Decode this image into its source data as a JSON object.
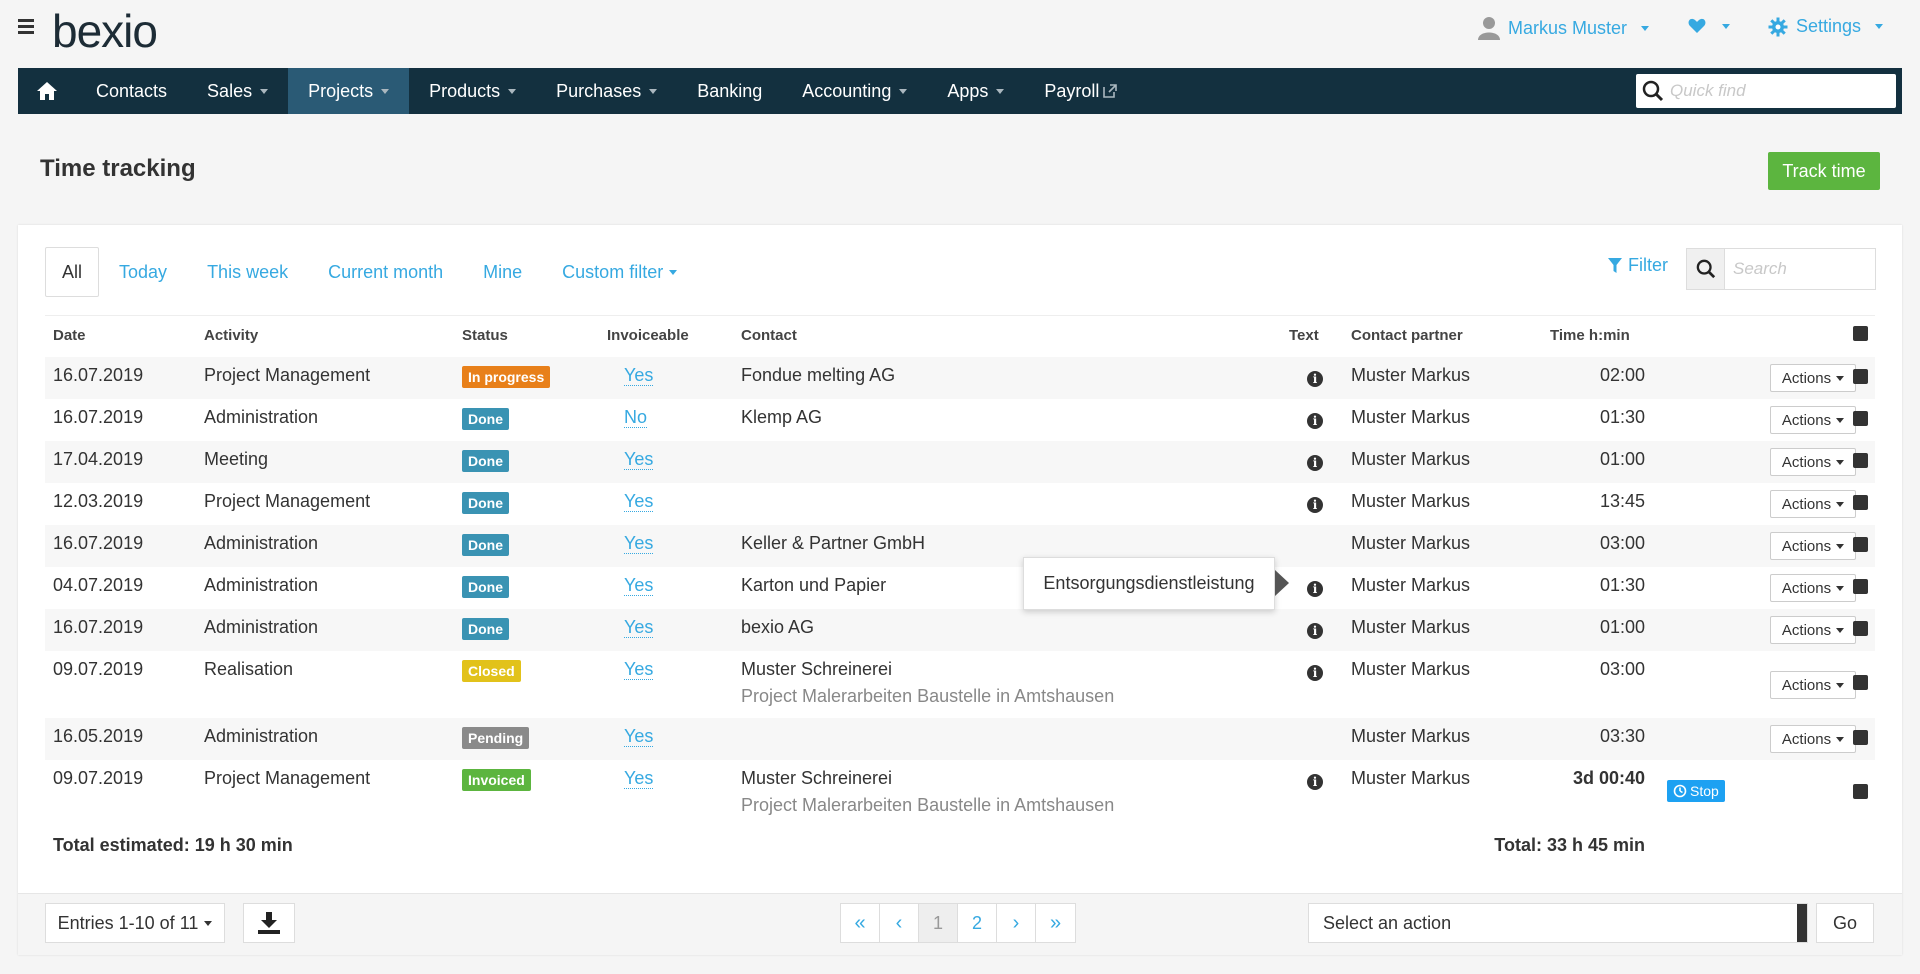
{
  "header": {
    "logo": "bexio",
    "user_name": "Markus Muster",
    "settings_label": "Settings"
  },
  "nav": {
    "items": [
      {
        "label": "Contacts",
        "caret": false
      },
      {
        "label": "Sales",
        "caret": true
      },
      {
        "label": "Projects",
        "caret": true,
        "active": true
      },
      {
        "label": "Products",
        "caret": true
      },
      {
        "label": "Purchases",
        "caret": true
      },
      {
        "label": "Banking",
        "caret": false
      },
      {
        "label": "Accounting",
        "caret": true
      },
      {
        "label": "Apps",
        "caret": true
      },
      {
        "label": "Payroll",
        "caret": false,
        "external": true
      }
    ],
    "quickfind_placeholder": "Quick find"
  },
  "page": {
    "title": "Time tracking",
    "track_button": "Track time"
  },
  "filters": {
    "tabs": [
      "All",
      "Today",
      "This week",
      "Current month",
      "Mine",
      "Custom filter"
    ],
    "active_tab": "All",
    "filter_label": "Filter",
    "search_placeholder": "Search"
  },
  "table": {
    "columns": {
      "date": "Date",
      "activity": "Activity",
      "status": "Status",
      "invoiceable": "Invoiceable",
      "contact": "Contact",
      "text": "Text",
      "contact_partner": "Contact partner",
      "time": "Time h:min"
    },
    "actions_label": "Actions",
    "stop_label": "Stop",
    "rows": [
      {
        "date": "16.07.2019",
        "activity": "Project Management",
        "status": "In progress",
        "status_color": "#e8801a",
        "invoiceable": "Yes",
        "contact": "Fondue melting AG",
        "project": "",
        "info": true,
        "partner": "Muster Markus",
        "time": "02:00"
      },
      {
        "date": "16.07.2019",
        "activity": "Administration",
        "status": "Done",
        "status_color": "#3a93b3",
        "invoiceable": "No",
        "contact": "Klemp AG",
        "project": "",
        "info": true,
        "partner": "Muster Markus",
        "time": "01:30"
      },
      {
        "date": "17.04.2019",
        "activity": "Meeting",
        "status": "Done",
        "status_color": "#3a93b3",
        "invoiceable": "Yes",
        "contact": "",
        "project": "",
        "info": true,
        "partner": "Muster Markus",
        "time": "01:00"
      },
      {
        "date": "12.03.2019",
        "activity": "Project Management",
        "status": "Done",
        "status_color": "#3a93b3",
        "invoiceable": "Yes",
        "contact": "",
        "project": "",
        "info": true,
        "partner": "Muster Markus",
        "time": "13:45"
      },
      {
        "date": "16.07.2019",
        "activity": "Administration",
        "status": "Done",
        "status_color": "#3a93b3",
        "invoiceable": "Yes",
        "contact": "Keller & Partner GmbH",
        "project": "",
        "info": false,
        "partner": "Muster Markus",
        "time": "03:00"
      },
      {
        "date": "04.07.2019",
        "activity": "Administration",
        "status": "Done",
        "status_color": "#3a93b3",
        "invoiceable": "Yes",
        "contact": "Karton und Papier",
        "project": "",
        "info": true,
        "partner": "Muster Markus",
        "time": "01:30"
      },
      {
        "date": "16.07.2019",
        "activity": "Administration",
        "status": "Done",
        "status_color": "#3a93b3",
        "invoiceable": "Yes",
        "contact": "bexio AG",
        "project": "",
        "info": true,
        "partner": "Muster Markus",
        "time": "01:00"
      },
      {
        "date": "09.07.2019",
        "activity": "Realisation",
        "status": "Closed",
        "status_color": "#e2c21a",
        "invoiceable": "Yes",
        "contact": "Muster Schreinerei",
        "project": "Project Malerarbeiten Baustelle in Amtshausen",
        "info": true,
        "partner": "Muster Markus",
        "time": "03:00"
      },
      {
        "date": "16.05.2019",
        "activity": "Administration",
        "status": "Pending",
        "status_color": "#8a8a8a",
        "invoiceable": "Yes",
        "contact": "",
        "project": "",
        "info": false,
        "partner": "Muster Markus",
        "time": "03:30"
      },
      {
        "date": "09.07.2019",
        "activity": "Project Management",
        "status": "Invoiced",
        "status_color": "#5cb53f",
        "invoiceable": "Yes",
        "contact": "Muster Schreinerei",
        "project": "Project Malerarbeiten Baustelle in Amtshausen",
        "info": true,
        "partner": "Muster Markus",
        "time": "3d 00:40",
        "running": true
      }
    ],
    "total_estimated": "Total estimated: 19 h 30 min",
    "total": "Total: 33 h 45 min"
  },
  "tooltip": {
    "text": "Entsorgungsdienstleistung"
  },
  "footer": {
    "entries_label": "Entries 1-10 of 11",
    "pages": [
      "«",
      "‹",
      "1",
      "2",
      "›",
      "»"
    ],
    "current_page": "1",
    "select_action_placeholder": "Select an action",
    "go_label": "Go"
  },
  "colors": {
    "nav_bg": "#13303f",
    "nav_active": "#2a5a75",
    "accent": "#36a9e1",
    "success": "#5cb53f"
  }
}
